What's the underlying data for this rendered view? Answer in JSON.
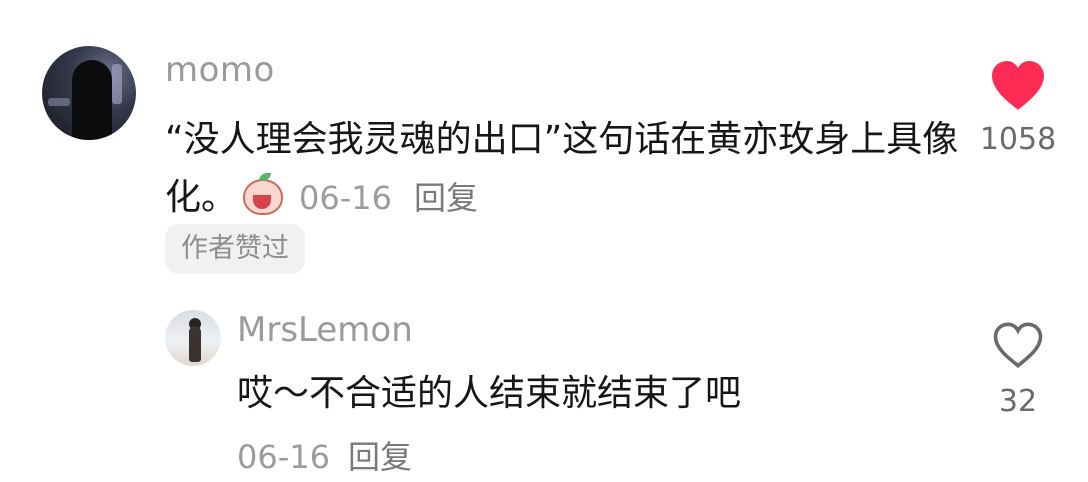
{
  "comment": {
    "username": "momo",
    "text": "“没人理会我灵魂的出口”这句话在黄亦玫身上具像化。",
    "date": "06-16",
    "reply_label": "回复",
    "badge": "作者赞过",
    "likes": "1058",
    "liked": true,
    "like_color": "#fe2c55"
  },
  "reply": {
    "username": "MrsLemon",
    "text": "哎～不合适的人结束就结束了吧",
    "date": "06-16",
    "reply_label": "回复",
    "likes": "32",
    "liked": false
  }
}
